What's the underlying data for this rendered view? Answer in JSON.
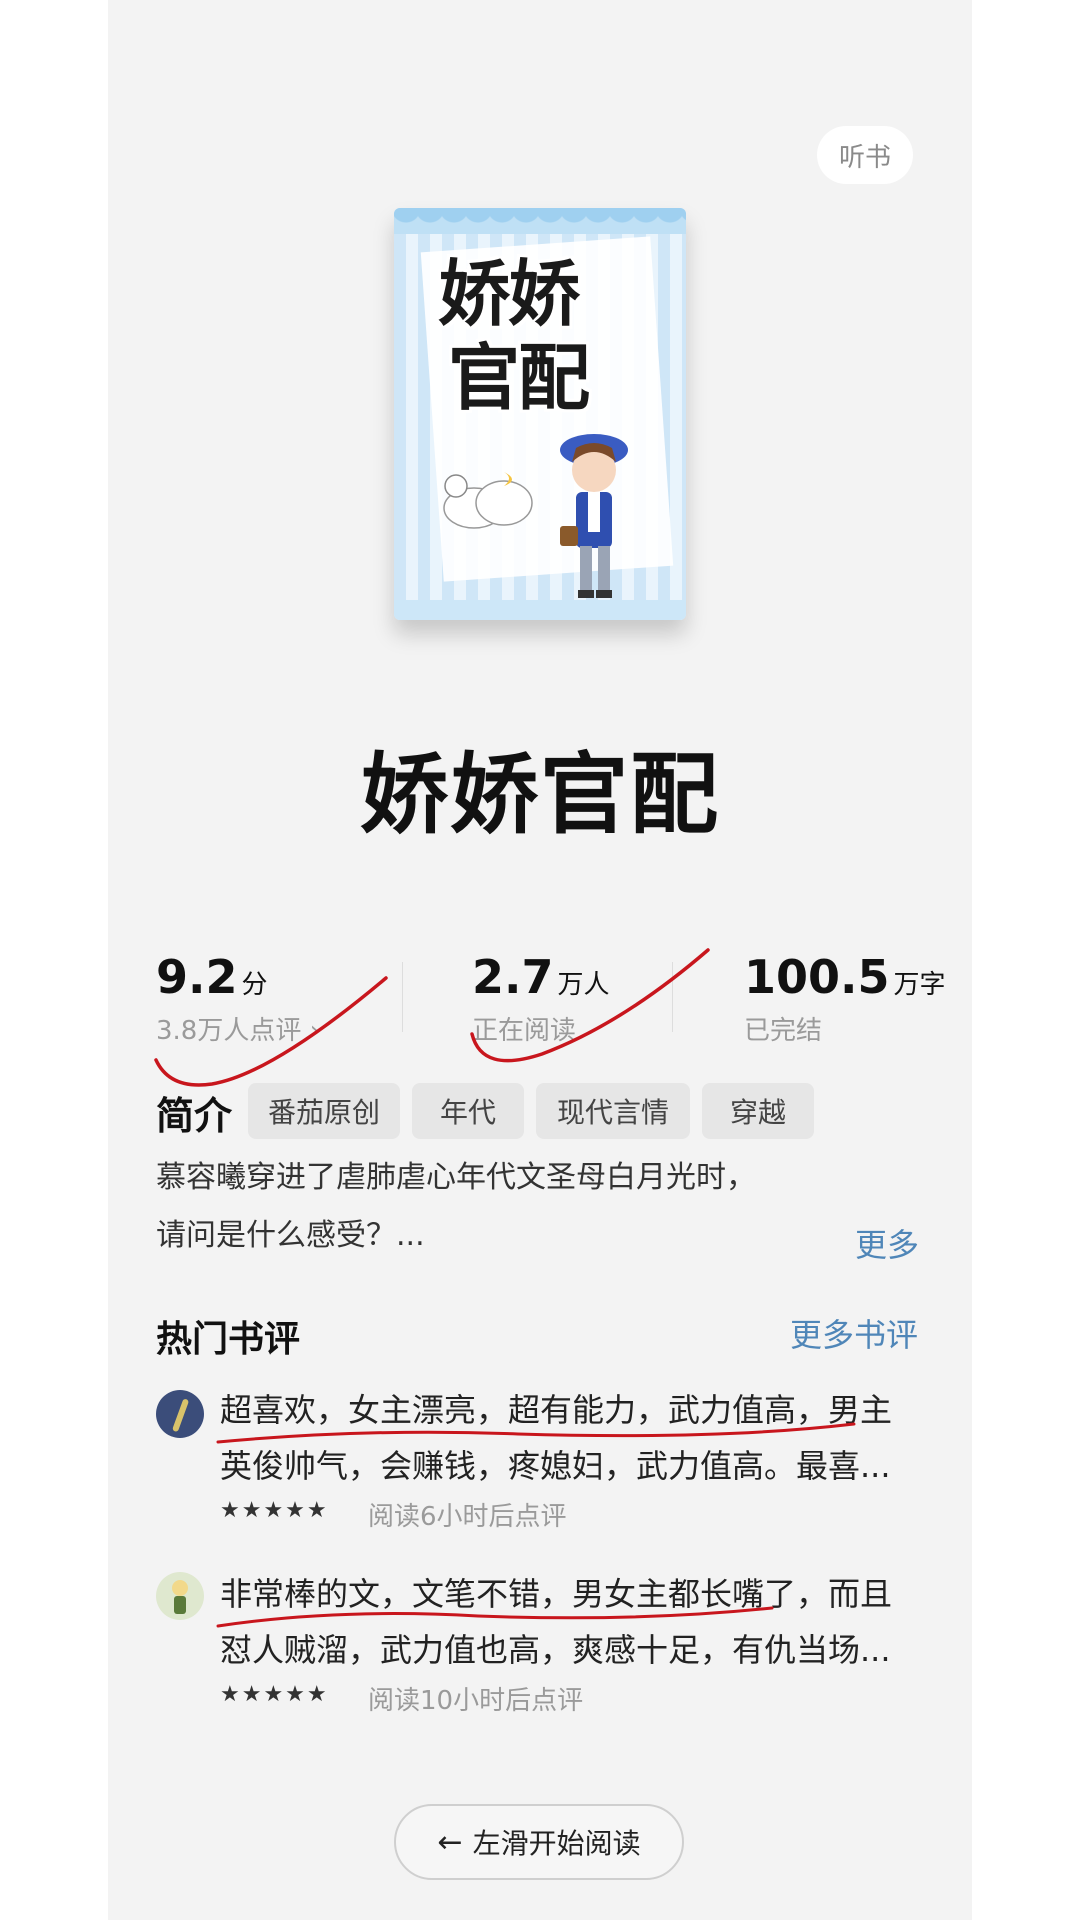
{
  "header": {
    "listen_label": "听书"
  },
  "book": {
    "cover_title_line1": "娇娇",
    "cover_title_line2": "官配",
    "title": "娇娇官配"
  },
  "stats": {
    "score_value": "9.2",
    "score_unit": "分",
    "score_sub": "3.8万人点评 ›",
    "readers_value": "2.7",
    "readers_unit": "万人",
    "readers_sub": "正在阅读",
    "words_value": "100.5",
    "words_unit": "万字",
    "words_sub": "已完结"
  },
  "intro": {
    "label": "简介",
    "tags": [
      "番茄原创",
      "年代",
      "现代言情",
      "穿越"
    ],
    "line1": "慕容曦穿进了虐肺虐心年代文圣母白月光时，",
    "line2": "请问是什么感受？...",
    "more_label": "更多"
  },
  "reviews_section": {
    "title": "热门书评",
    "more_label": "更多书评",
    "items": [
      {
        "line1": "超喜欢，女主漂亮，超有能力，武力值高，男主",
        "line2": "英俊帅气，会赚钱，疼媳妇，武力值高。最喜...",
        "stars": "★★★★★",
        "rating": 5,
        "meta": "阅读6小时后点评"
      },
      {
        "line1": "非常棒的文，文笔不错，男女主都长嘴了，而且",
        "line2": "怼人贼溜，武力值也高，爽感十足，有仇当场...",
        "stars": "★★★★★",
        "rating": 5,
        "meta": "阅读10小时后点评"
      }
    ]
  },
  "footer": {
    "start_label": "左滑开始阅读"
  },
  "colors": {
    "accent_link": "#4f86b8",
    "annotation_red": "#c8161d",
    "page_bg": "#f3f3f3"
  }
}
